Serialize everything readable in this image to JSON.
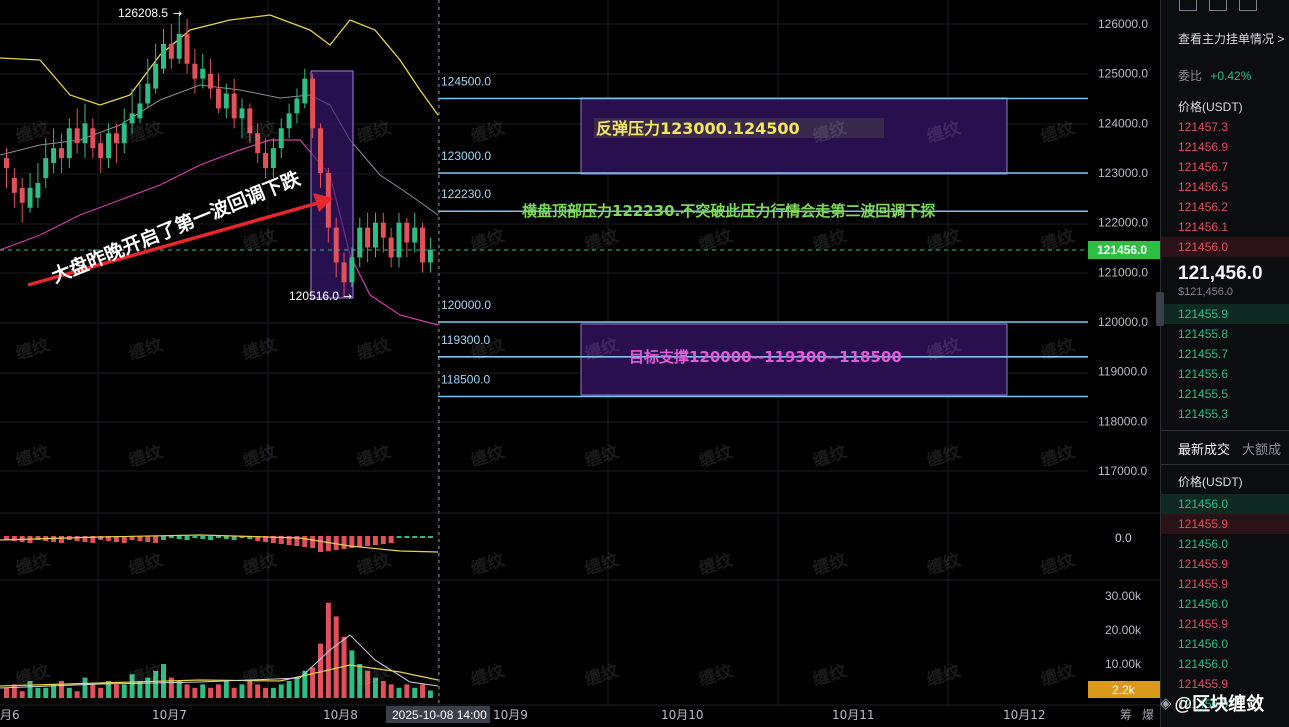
{
  "chart": {
    "price_axis": [
      "126000.0",
      "125000.0",
      "124000.0",
      "123000.0",
      "122000.0",
      "121000.0",
      "120000.0",
      "119000.0",
      "118000.0",
      "117000.0"
    ],
    "current_price_tag": "121456.0",
    "macd_zero": "0.0",
    "volume_axis": [
      "30.00k",
      "20.00k",
      "10.00k"
    ],
    "volume_current_tag": "2.2k",
    "x_axis_labels": [
      "月6",
      "10月7",
      "10月8",
      "10月9",
      "10月10",
      "10月11",
      "10月12"
    ],
    "crosshair_time": "2025-10-08 14:00",
    "corner_label_left": "筹",
    "corner_label_right": "爆",
    "high_label": "126208.5",
    "low_label": "120516.0",
    "level_labels": [
      "124500.0",
      "123000.0",
      "122230.0",
      "120000.0",
      "119300.0",
      "118500.0"
    ],
    "annotations": {
      "rebound_resistance": "反弹压力123000.124500",
      "sideways_top": "横盘顶部压力122230.不突破此压力行情会走第二波回调下探",
      "target_support": "目标支撑120000--119300--118500",
      "arrow_text": "大盘昨晚开启了第一波回调下跌"
    },
    "colors": {
      "up": "#2ebd85",
      "down": "#e2505a",
      "level_line": "#7fc4ee",
      "box_fill": "#2a0f4f"
    },
    "watermark_text": "缠纹"
  },
  "orderbook": {
    "link_text": "查看主力挂单情况",
    "ratio_label": "委比",
    "ratio_value": "+0.42%",
    "header": "价格(USDT)",
    "asks": [
      "121457.3",
      "121456.9",
      "121456.7",
      "121456.5",
      "121456.2",
      "121456.1",
      "121456.0"
    ],
    "last_price": "121,456.0",
    "last_price_usd": "$121,456.0",
    "bids": [
      "121455.9",
      "121455.8",
      "121455.7",
      "121455.6",
      "121455.5",
      "121455.3"
    ],
    "tab_active": "最新成交",
    "tab_other": "大额成",
    "trades_header": "价格(USDT)",
    "trades": [
      {
        "price": "121456.0",
        "side": "bid"
      },
      {
        "price": "121455.9",
        "side": "ask"
      },
      {
        "price": "121456.0",
        "side": "bid"
      },
      {
        "price": "121455.9",
        "side": "ask"
      },
      {
        "price": "121455.9",
        "side": "ask"
      },
      {
        "price": "121456.0",
        "side": "bid"
      },
      {
        "price": "121455.9",
        "side": "ask"
      },
      {
        "price": "121456.0",
        "side": "bid"
      },
      {
        "price": "121456.0",
        "side": "bid"
      },
      {
        "price": "121455.9",
        "side": "ask"
      },
      {
        "price": "121456.0",
        "side": "bid"
      }
    ]
  },
  "brand": {
    "text": "@区块缠敛"
  }
}
